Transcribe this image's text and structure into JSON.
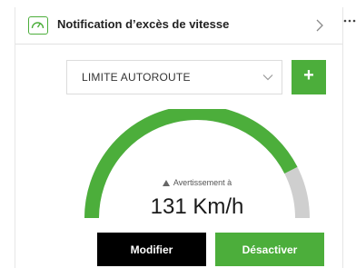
{
  "header": {
    "title": "Notification d’excès de vitesse",
    "icon": "speedometer-icon",
    "chevron_icon": "chevron-right-icon"
  },
  "more_icon": "more-dots-icon",
  "limit_select": {
    "selected": "LIMITE AUTOROUTE",
    "chevron_icon": "chevron-down-icon"
  },
  "add_button": {
    "label": "+"
  },
  "gauge": {
    "caption": "Avertissement à",
    "value_text": "131 Km/h",
    "filled_fraction": 0.85,
    "colors": {
      "filled": "#4cae3b",
      "remaining": "#cfcfcf"
    }
  },
  "actions": {
    "modify_label": "Modifier",
    "disable_label": "Désactiver"
  },
  "colors": {
    "accent": "#4cae3b",
    "dark_button": "#000000"
  }
}
